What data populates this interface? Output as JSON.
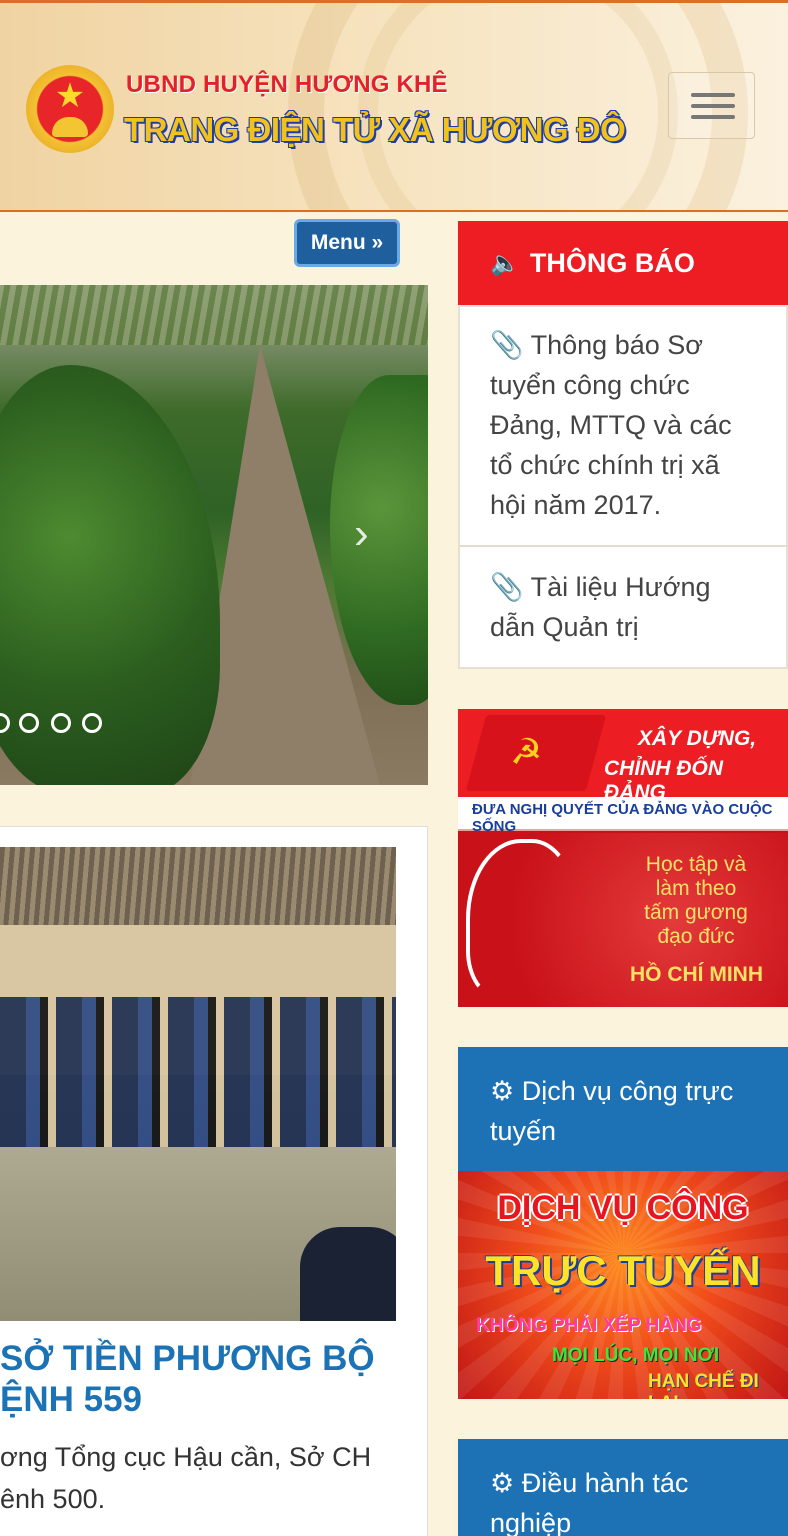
{
  "header": {
    "subtitle": "UBND HUYỆN HƯƠNG KHÊ",
    "title": "TRANG ĐIỆN TỬ XÃ HƯƠNG ĐÔ",
    "emblem_icon": "national-emblem-icon",
    "menu_icon": "hamburger-icon"
  },
  "main": {
    "menu_button": "Menu »",
    "slider": {
      "next_icon": "chevron-right-icon",
      "dots": 4
    },
    "news": {
      "title": "SỞ TIỀN PHƯƠNG BỘ\nỆNH 559",
      "excerpt": "ơng Tổng cục Hậu cần, Sở CH\nênh 500."
    }
  },
  "sidebar": {
    "announcements": {
      "heading": "THÔNG BÁO",
      "heading_icon": "speaker-icon",
      "items": [
        {
          "icon": "paperclip-icon",
          "text": "Thông báo Sơ tuyển công chức Đảng, MTTQ và các tổ chức chính trị xã hội năm 2017."
        },
        {
          "icon": "paperclip-icon",
          "text": "Tài liệu Hướng dẫn Quản trị"
        }
      ]
    },
    "party_banner": {
      "line1": "XÂY DỰNG,",
      "line2": "CHỈNH ĐỐN ĐẢNG",
      "strip": "ĐƯA NGHỊ QUYẾT CỦA ĐẢNG VÀO CUỘC SỐNG",
      "study1": "Học tập và",
      "study2": "làm theo",
      "study3": "tấm gương",
      "study4": "đạo đức",
      "name": "HỒ CHÍ MINH"
    },
    "online_service": {
      "heading": "Dịch vụ công trực tuyến",
      "heading_icon": "gear-icon",
      "banner_line1": "DỊCH VỤ CÔNG",
      "banner_line2": "TRỰC TUYẾN",
      "banner_line3": "KHÔNG PHẢI XẾP HÀNG",
      "banner_line4": "MỌI LÚC, MỌI NƠI",
      "banner_line5": "HẠN CHẾ ĐI LẠI"
    },
    "operations": {
      "heading": "Điều hành tác nghiệp",
      "heading_icon": "gear-icon"
    }
  },
  "colors": {
    "header_border": "#d7712a",
    "announce_red": "#ee1c23",
    "service_blue": "#1d71b5",
    "news_title_blue": "#1b73b5",
    "page_bg": "#fcf3dd"
  }
}
